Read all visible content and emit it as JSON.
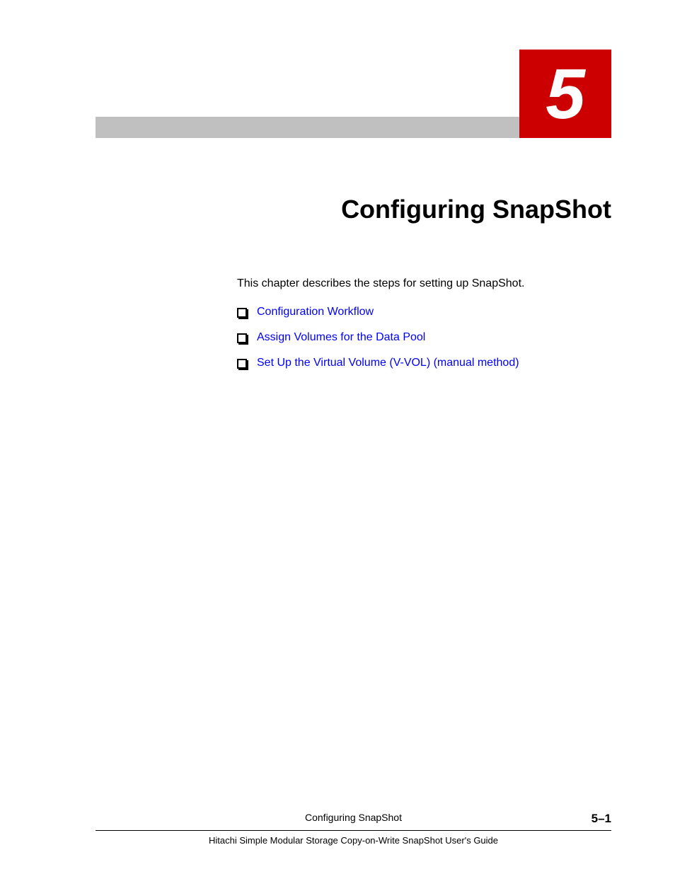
{
  "chapter": {
    "number": "5",
    "title": "Configuring SnapShot"
  },
  "content": {
    "intro": "This chapter describes the steps for setting up SnapShot.",
    "toc_items": [
      "Configuration Workflow",
      "Assign Volumes for the Data Pool",
      "Set Up the Virtual Volume (V-VOL) (manual method)"
    ]
  },
  "footer": {
    "section": "Configuring SnapShot",
    "page": "5–1",
    "guide": "Hitachi Simple Modular Storage Copy-on-Write SnapShot User's Guide"
  }
}
